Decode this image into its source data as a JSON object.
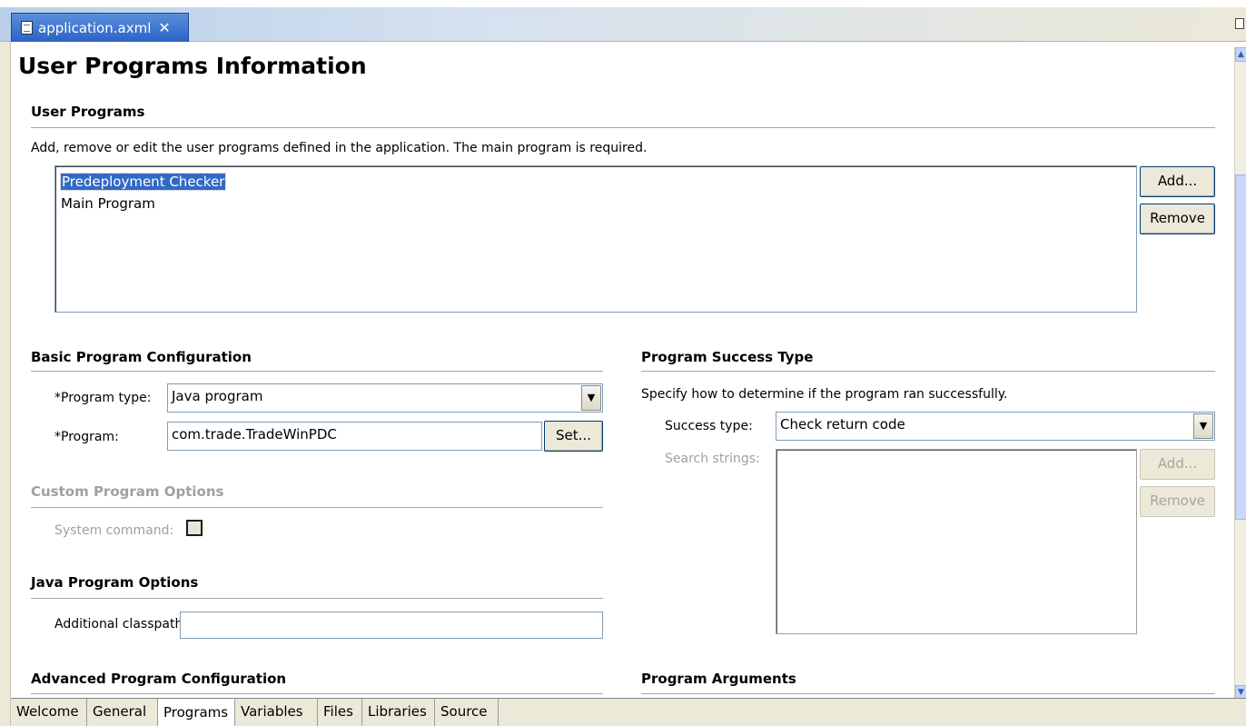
{
  "editor_tab": {
    "title": "application.axml"
  },
  "page": {
    "title": "User Programs Information"
  },
  "user_programs": {
    "heading": "User Programs",
    "description": "Add, remove or edit the user programs defined in the application. The main program is required.",
    "items": [
      "Predeployment Checker",
      "Main Program"
    ],
    "selected_index": 0,
    "add_label": "Add...",
    "remove_label": "Remove"
  },
  "basic_config": {
    "heading": "Basic Program Configuration",
    "program_type_label": "*Program type:",
    "program_type_value": "Java program",
    "program_label": "*Program:",
    "program_value": "com.trade.TradeWinPDC",
    "set_label": "Set..."
  },
  "custom_options": {
    "heading": "Custom Program Options",
    "system_command_label": "System command:",
    "system_command_checked": false
  },
  "java_options": {
    "heading": "Java Program Options",
    "classpath_label": "Additional classpath:",
    "classpath_value": ""
  },
  "advanced_config": {
    "heading": "Advanced Program Configuration"
  },
  "success_type": {
    "heading": "Program Success Type",
    "description": "Specify how to determine if the program ran successfully.",
    "type_label": "Success type:",
    "type_value": "Check return code",
    "search_label": "Search strings:",
    "add_label": "Add...",
    "remove_label": "Remove"
  },
  "program_arguments": {
    "heading": "Program Arguments"
  },
  "bottom_tabs": [
    "Welcome",
    "General",
    "Programs",
    "Variables",
    "Files",
    "Libraries",
    "Source"
  ],
  "active_tab": "Programs",
  "colors": {
    "selection": "#316ac5",
    "tab_active": "#2c63c6",
    "disabled_text": "#a0a0a0"
  }
}
